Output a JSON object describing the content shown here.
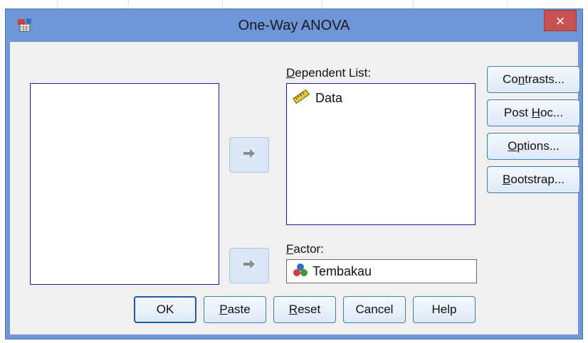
{
  "window": {
    "title": "One-Way ANOVA",
    "close_glyph": "×"
  },
  "variable_list": {
    "items": []
  },
  "dependent_list": {
    "label_mnemonic": "D",
    "label_rest": "ependent List:",
    "items": [
      {
        "name": "Data",
        "icon": "ruler-scale-icon"
      }
    ]
  },
  "factor": {
    "label_mnemonic": "F",
    "label_rest": "actor:",
    "value": "Tembakau",
    "icon": "nominal-variable-icon"
  },
  "side_buttons": {
    "contrasts": {
      "pre": "Co",
      "mnemonic": "n",
      "post": "trasts..."
    },
    "post_hoc": {
      "pre": "Post ",
      "mnemonic": "H",
      "post": "oc..."
    },
    "options": {
      "pre": "",
      "mnemonic": "O",
      "post": "ptions..."
    },
    "bootstrap": {
      "pre": "",
      "mnemonic": "B",
      "post": "ootstrap..."
    }
  },
  "bottom_buttons": {
    "ok": "OK",
    "paste": {
      "mnemonic": "P",
      "post": "aste"
    },
    "reset": {
      "mnemonic": "R",
      "post": "eset"
    },
    "cancel": "Cancel",
    "help": "Help"
  },
  "colors": {
    "titlebar": "#6f96d8",
    "client": "#f0f0f0",
    "list_border": "#1c1c9c",
    "close_button": "#c75050"
  }
}
